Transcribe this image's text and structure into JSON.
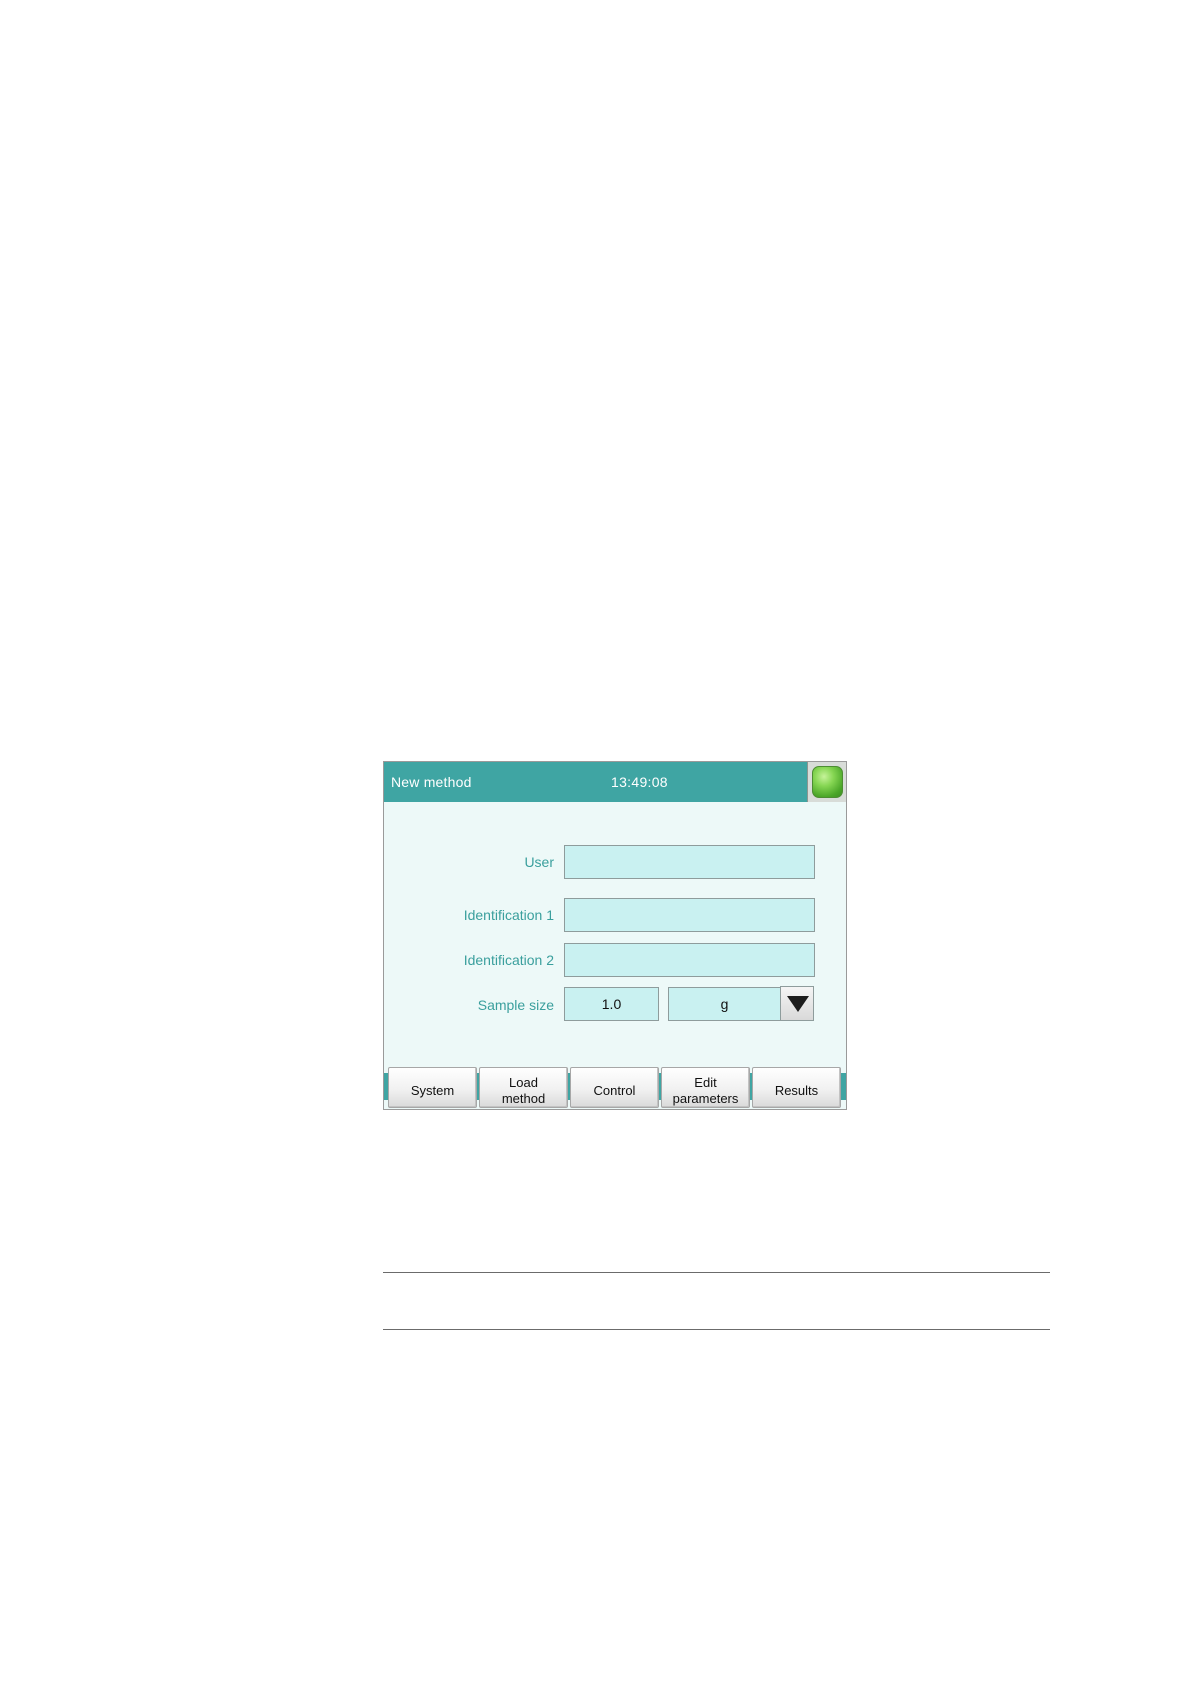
{
  "screen": {
    "title": "New method",
    "time": "13:49:08",
    "status_light": "green"
  },
  "form": {
    "user": {
      "label": "User",
      "value": ""
    },
    "identification_1": {
      "label": "Identification 1",
      "value": ""
    },
    "identification_2": {
      "label": "Identification 2",
      "value": ""
    },
    "sample_size": {
      "label": "Sample size",
      "value": "1.0",
      "unit": "g"
    }
  },
  "softkeys": {
    "system": {
      "line1": "System",
      "line2": ""
    },
    "load_method": {
      "line1": "Load",
      "line2": "method"
    },
    "control": {
      "line1": "Control",
      "line2": ""
    },
    "edit_parameters": {
      "line1": "Edit",
      "line2": "parameters"
    },
    "results": {
      "line1": "Results",
      "line2": ""
    }
  },
  "colors": {
    "accent": "#3fa5a3",
    "field_bg": "#c9f1f1",
    "label": "#3a9f9d",
    "screen_bg": "#edf9f8",
    "status_green": "#6cc63e"
  }
}
